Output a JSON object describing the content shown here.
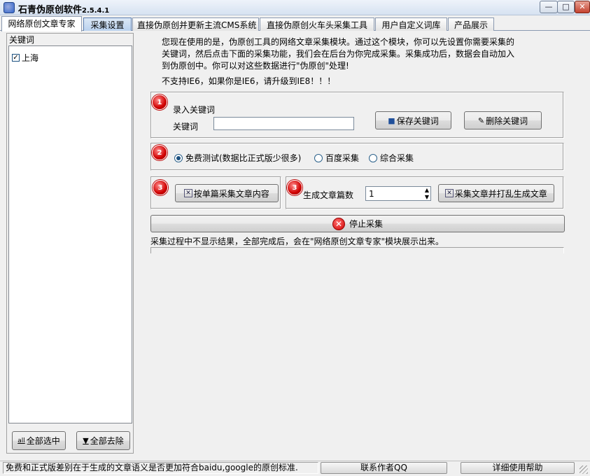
{
  "window": {
    "title": "石青伪原创软件",
    "version": "2.5.4.1",
    "min_glyph": "—",
    "max_glyph": "□",
    "close_glyph": "✕"
  },
  "tabs": [
    {
      "label": "网络原创文章专家",
      "active": true
    },
    {
      "label": "采集设置",
      "active": false,
      "highlight": true
    },
    {
      "label": "直接伪原创并更新主流CMS系统",
      "active": false
    },
    {
      "label": "直接伪原创火车头采集工具",
      "active": false
    },
    {
      "label": "用户自定义词库",
      "active": false
    },
    {
      "label": "产品展示",
      "active": false
    }
  ],
  "left_panel": {
    "label": "关键词",
    "items": [
      {
        "text": "上海",
        "checked": true
      }
    ],
    "select_all": "全部选中",
    "deselect_all": "全部去除",
    "select_all_icon": "all",
    "deselect_all_icon": "▼"
  },
  "intro": {
    "line1": "您现在使用的是，伪原创工具的网络文章采集模块。通过这个模块，你可以先设置你需要采集的",
    "line2": "关键词，然后点击下面的采集功能，我们会在后台为你完成采集。采集成功后，数据会自动加入",
    "line3": "到伪原创中。你可以对这些数据进行\"伪原创\"处理!",
    "ie_note": "不支持IE6，如果你是IE6，请升级到IE8！！！"
  },
  "step1": {
    "badge": "1",
    "title": "录入关键词",
    "field_label": "关键词",
    "keyword_value": "",
    "save_label": "保存关键词",
    "delete_label": "删除关键词"
  },
  "step2": {
    "badge": "2",
    "options": [
      {
        "label": "免费测试(数据比正式版少很多)",
        "selected": true
      },
      {
        "label": "百度采集",
        "selected": false
      },
      {
        "label": "综合采集",
        "selected": false
      }
    ]
  },
  "step3a": {
    "badge": "3",
    "button_label": "按单篇采集文章内容"
  },
  "step3b": {
    "badge": "3",
    "count_label": "生成文章篇数",
    "count_value": "1",
    "button_label": "采集文章并打乱生成文章"
  },
  "stop": {
    "icon": "✕",
    "label": "停止采集"
  },
  "note": "采集过程中不显示结果，全部完成后，会在\"网络原创文章专家\"模块展示出来。",
  "statusbar": {
    "message": "免费和正式版差别在于生成的文章语义是否更加符合baidu,google的原创标准.",
    "contact": "联系作者QQ",
    "help": "详细使用帮助"
  }
}
